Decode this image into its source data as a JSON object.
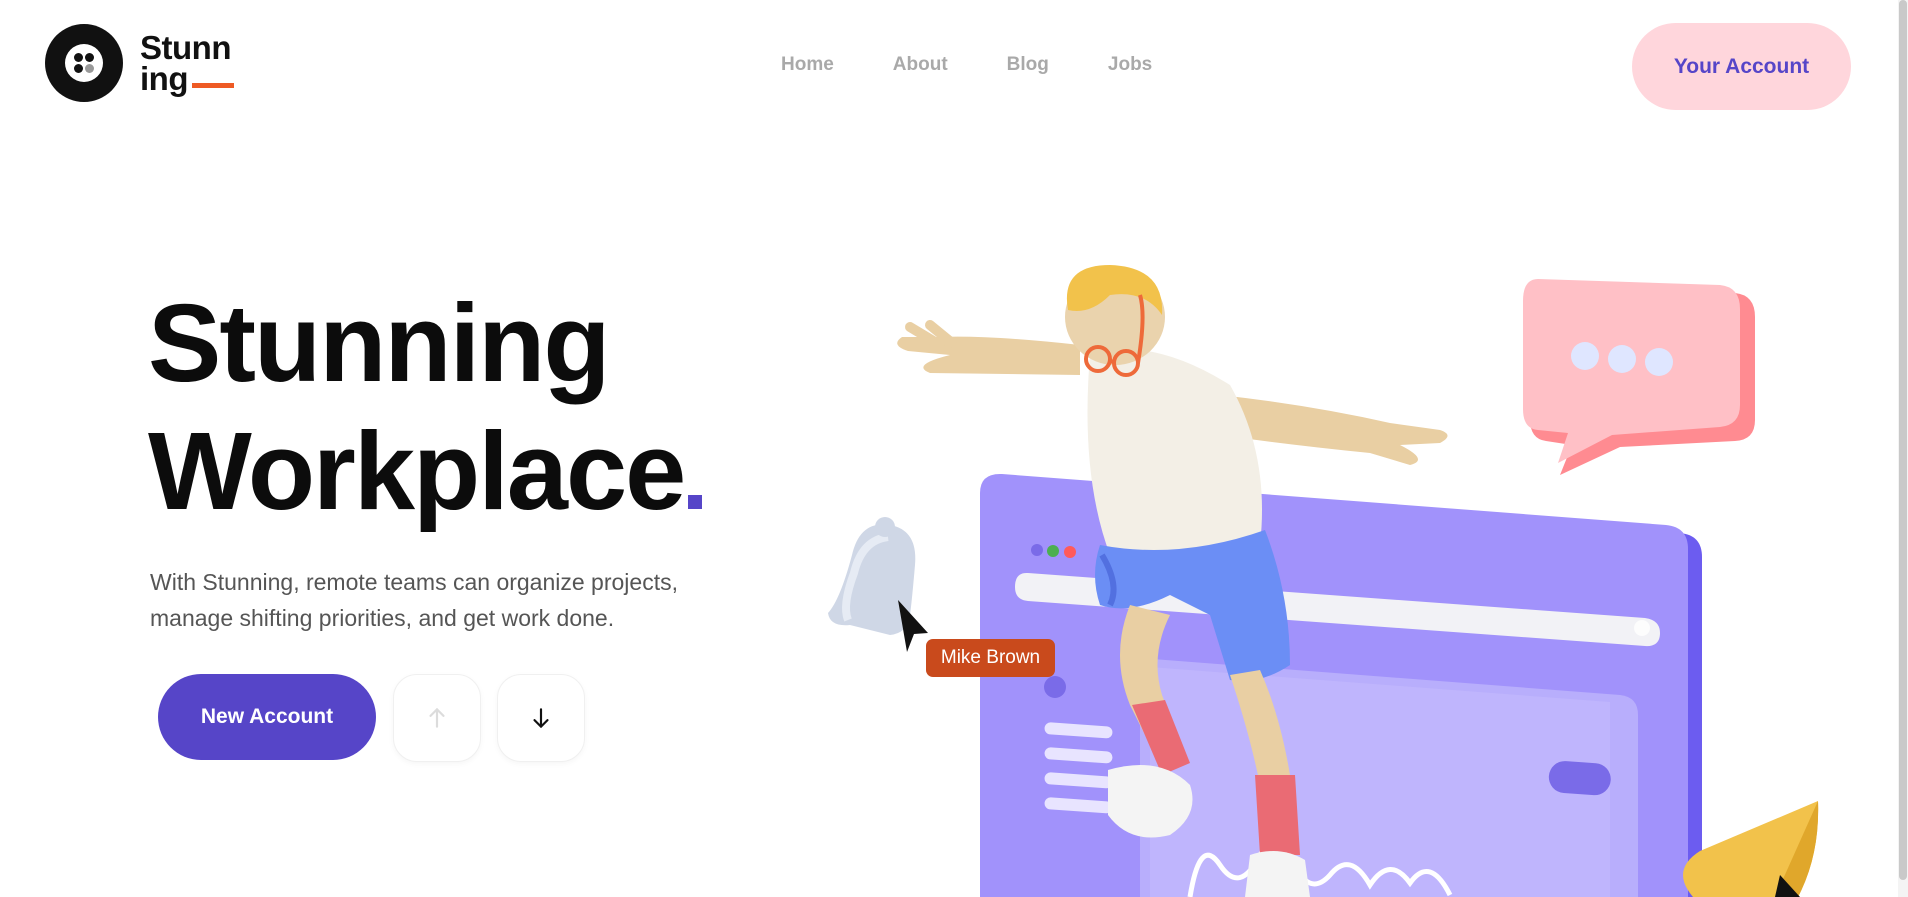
{
  "logo": {
    "line1": "Stunn",
    "line2": "ing"
  },
  "nav": {
    "items": [
      "Home",
      "About",
      "Blog",
      "Jobs"
    ]
  },
  "header": {
    "account_label": "Your Account"
  },
  "hero": {
    "title_line1": "Stunning",
    "title_line2": "Workplace",
    "description_line1": "With Stunning, remote teams can organize projects,",
    "description_line2": "manage shifting priorities, and get work done.",
    "new_account_label": "New Account"
  },
  "illustration": {
    "user_tag": "Mike Brown"
  },
  "colors": {
    "accent": "#5645c8",
    "account_button_bg": "#ffd6dc",
    "logo_underline": "#ee5a24",
    "user_tag_bg": "#c94a1c"
  },
  "icons": [
    "logo-mark-icon",
    "arrow-up-icon",
    "arrow-down-icon",
    "bell-icon",
    "cursor-icon",
    "chat-bubble-icon",
    "cone-icon"
  ]
}
